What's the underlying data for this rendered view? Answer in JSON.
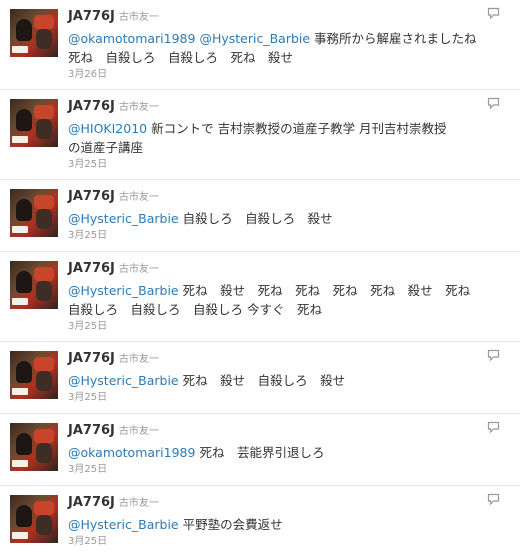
{
  "tweets": [
    {
      "screen_name": "JA776J",
      "real_name": "古市友一",
      "mentions": [
        "@okamotomari1989",
        "@Hysteric_Barbie"
      ],
      "text_line1": " 事務所から解雇されましたね",
      "text_line2": "死ね　自殺しろ　自殺しろ　死ね　殺せ",
      "time": "3月26日",
      "has_reply_icon": true
    },
    {
      "screen_name": "JA776J",
      "real_name": "古市友一",
      "mentions": [
        "@HIOKI2010"
      ],
      "text_line1": " 新コントで 吉村崇教授の道産子教学 月刊吉村崇教授",
      "text_line2": "の道産子講座",
      "time": "3月25日",
      "has_reply_icon": true
    },
    {
      "screen_name": "JA776J",
      "real_name": "古市友一",
      "mentions": [
        "@Hysteric_Barbie"
      ],
      "text_line1": " 自殺しろ　自殺しろ　殺せ",
      "text_line2": "",
      "time": "3月25日",
      "has_reply_icon": false
    },
    {
      "screen_name": "JA776J",
      "real_name": "古市友一",
      "mentions": [
        "@Hysteric_Barbie"
      ],
      "text_line1": " 死ね　殺せ　死ね　死ね　死ね　死ね　殺せ　死ね",
      "text_line2": "自殺しろ　自殺しろ　自殺しろ 今すぐ　死ね",
      "time": "3月25日",
      "has_reply_icon": false
    },
    {
      "screen_name": "JA776J",
      "real_name": "古市友一",
      "mentions": [
        "@Hysteric_Barbie"
      ],
      "text_line1": " 死ね　殺せ　自殺しろ　殺せ",
      "text_line2": "",
      "time": "3月25日",
      "has_reply_icon": true
    },
    {
      "screen_name": "JA776J",
      "real_name": "古市友一",
      "mentions": [
        "@okamotomari1989"
      ],
      "text_line1": " 死ね　芸能界引退しろ",
      "text_line2": "",
      "time": "3月25日",
      "has_reply_icon": true
    },
    {
      "screen_name": "JA776J",
      "real_name": "古市友一",
      "mentions": [
        "@Hysteric_Barbie"
      ],
      "text_line1": " 平野塾の会費返せ",
      "text_line2": "",
      "time": "3月25日",
      "has_reply_icon": true
    }
  ],
  "colors": {
    "mention": "#2b7bb9",
    "text": "#333333",
    "meta": "#999999"
  },
  "icons": {
    "reply": "reply-icon"
  }
}
